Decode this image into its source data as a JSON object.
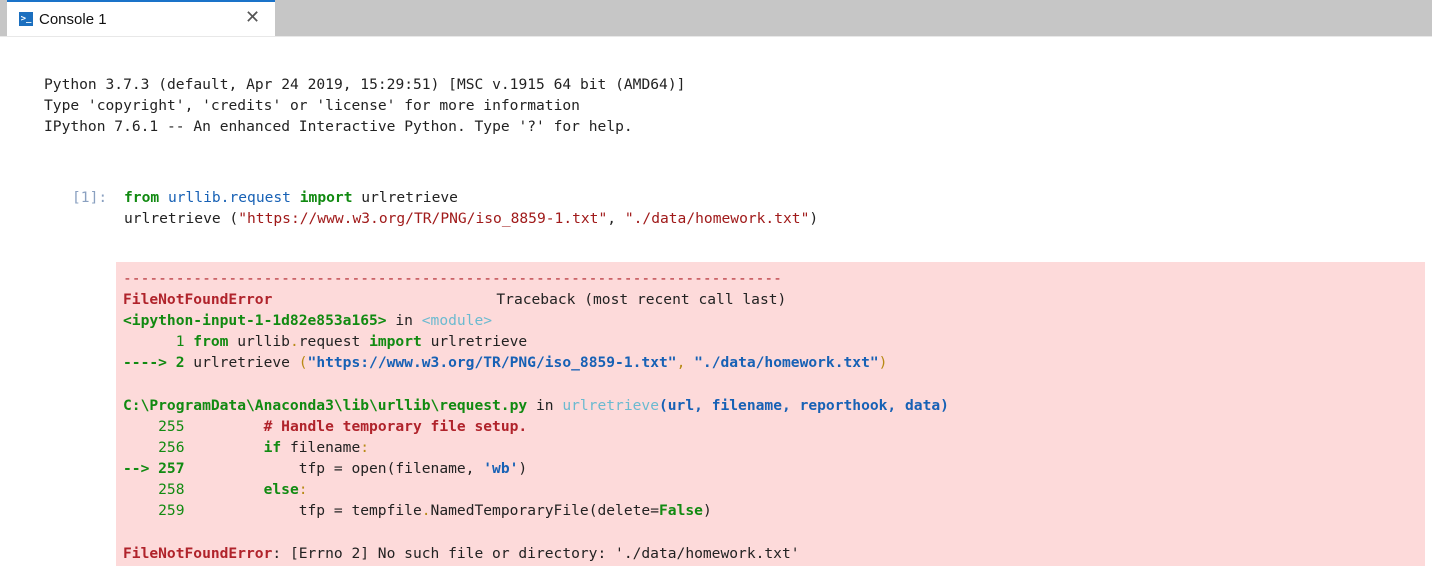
{
  "tab": {
    "icon": "terminal-icon",
    "label": "Console 1",
    "close": "✕"
  },
  "banner": [
    "Python 3.7.3 (default, Apr 24 2019, 15:29:51) [MSC v.1915 64 bit (AMD64)]",
    "Type 'copyright', 'credits' or 'license' for more information",
    "IPython 7.6.1 -- An enhanced Interactive Python. Type '?' for help."
  ],
  "input": {
    "prompt": "[1]:",
    "line1": {
      "kw1": "from",
      "module": "urllib.request",
      "kw2": "import",
      "name": "urlretrieve"
    },
    "line2": {
      "call": "urlretrieve (",
      "arg1": "\"https://www.w3.org/TR/PNG/iso_8859-1.txt\"",
      "sep": ", ",
      "arg2": "\"./data/homework.txt\"",
      "close": ")"
    }
  },
  "traceback": {
    "dashes": "---------------------------------------------------------------------------",
    "error_name": "FileNotFoundError",
    "traceback_label": "Traceback (most recent call last)",
    "frame1": {
      "file": "<ipython-input-1-1d82e853a165>",
      "in": " in ",
      "func": "<module>"
    },
    "frame1_lines": [
      {
        "num": "      1 ",
        "text_kw1": "from",
        "text_mid": " urllib",
        "dot": ".",
        "text_mod": "request ",
        "text_kw2": "import",
        "text_end": " urlretrieve"
      },
      {
        "arrow": "----> 2 ",
        "call": "urlretrieve ",
        "paren": "(",
        "arg1": "\"https://www.w3.org/TR/PNG/iso_8859-1.txt\"",
        "sep": ", ",
        "arg2": "\"./data/homework.txt\"",
        "close": ")"
      }
    ],
    "frame2": {
      "file": "C:\\ProgramData\\Anaconda3\\lib\\urllib\\request.py",
      "in": " in ",
      "func": "urlretrieve",
      "args": "(url, filename, reporthook, data)"
    },
    "frame2_lines": [
      {
        "num": "    255 ",
        "indent": "        ",
        "comment": "# Handle temporary file setup."
      },
      {
        "num": "    256 ",
        "indent": "        ",
        "kw": "if",
        "rest": " filename",
        "colon": ":"
      },
      {
        "num": "--> 257 ",
        "indent": "            ",
        "rest": "tfp = open(filename, ",
        "str": "'wb'",
        "close": ")"
      },
      {
        "num": "    258 ",
        "indent": "        ",
        "kw": "else",
        "colon": ":"
      },
      {
        "num": "    259 ",
        "indent": "            ",
        "rest": "tfp = tempfile",
        "dot": ".",
        "rest2": "NamedTemporaryFile(delete=",
        "kw": "False",
        "close": ")"
      }
    ],
    "final_error": "FileNotFoundError",
    "final_msg": ": [Errno 2] No such file or directory: './data/homework.txt'"
  },
  "colors": {
    "tab_accent": "#1a73c9",
    "error_bg": "#fddada",
    "keyword": "#118a11",
    "error_red": "#b0232b"
  }
}
